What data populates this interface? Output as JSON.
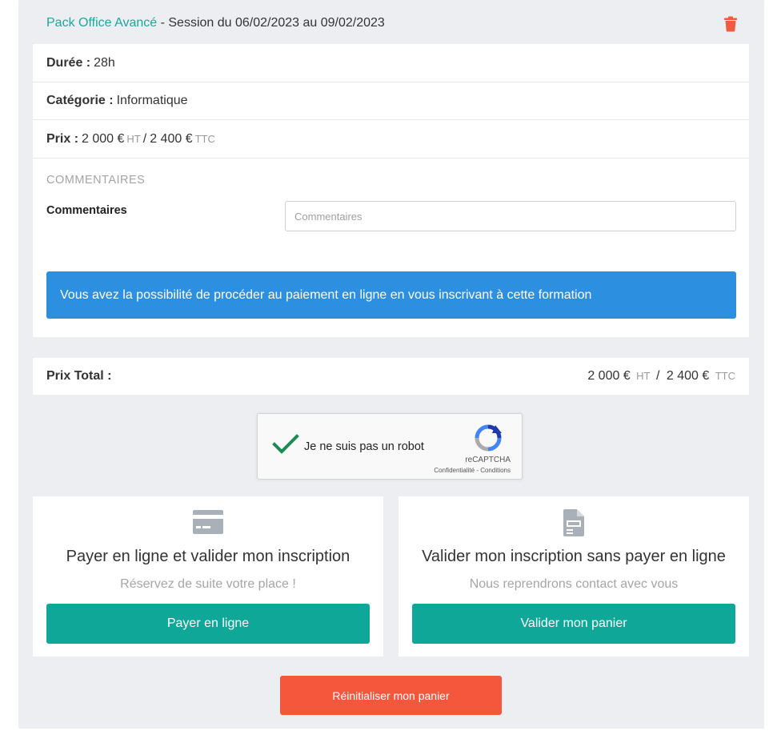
{
  "header": {
    "course_name": "Pack Office Avancé",
    "session_text": " - Session du 06/02/2023 au 09/02/2023",
    "delete_icon": "trash-icon"
  },
  "details": {
    "duree_label": "Durée :",
    "duree_value": "28h",
    "categorie_label": "Catégorie :",
    "categorie_value": "Informatique",
    "prix_label": "Prix :",
    "prix_ht_value": "2 000 €",
    "ht_suffix": "HT",
    "separator": "/",
    "prix_ttc_value": "2 400 €",
    "ttc_suffix": "TTC"
  },
  "comments": {
    "section_title": "COMMENTAIRES",
    "label": "Commentaires",
    "placeholder": "Commentaires",
    "value": ""
  },
  "info_banner": "Vous avez la possibilité de procéder au paiement en ligne en vous inscrivant à cette formation",
  "total": {
    "label": "Prix Total :",
    "ht_value": "2 000 €",
    "ht_suffix": "HT",
    "separator": "/",
    "ttc_value": "2 400 €",
    "ttc_suffix": "TTC"
  },
  "captcha": {
    "checked": true,
    "text": "Je ne suis pas un robot",
    "brand": "reCAPTCHA",
    "links": "Confidentialité - Conditions"
  },
  "options": [
    {
      "icon": "credit-card-icon",
      "title": "Payer en ligne et valider mon inscription",
      "subtitle": "Réservez de suite votre place !",
      "button": "Payer en ligne"
    },
    {
      "icon": "document-icon",
      "title": "Valider mon inscription sans payer en ligne",
      "subtitle": "Nous reprendrons contact avec vous",
      "button": "Valider mon panier"
    }
  ],
  "reset_button": "Réinitialiser mon panier",
  "colors": {
    "accent_teal": "#0fa898",
    "info_blue": "#2d8fe0",
    "danger_red": "#f5573c",
    "panel_bg": "#edeef2"
  }
}
